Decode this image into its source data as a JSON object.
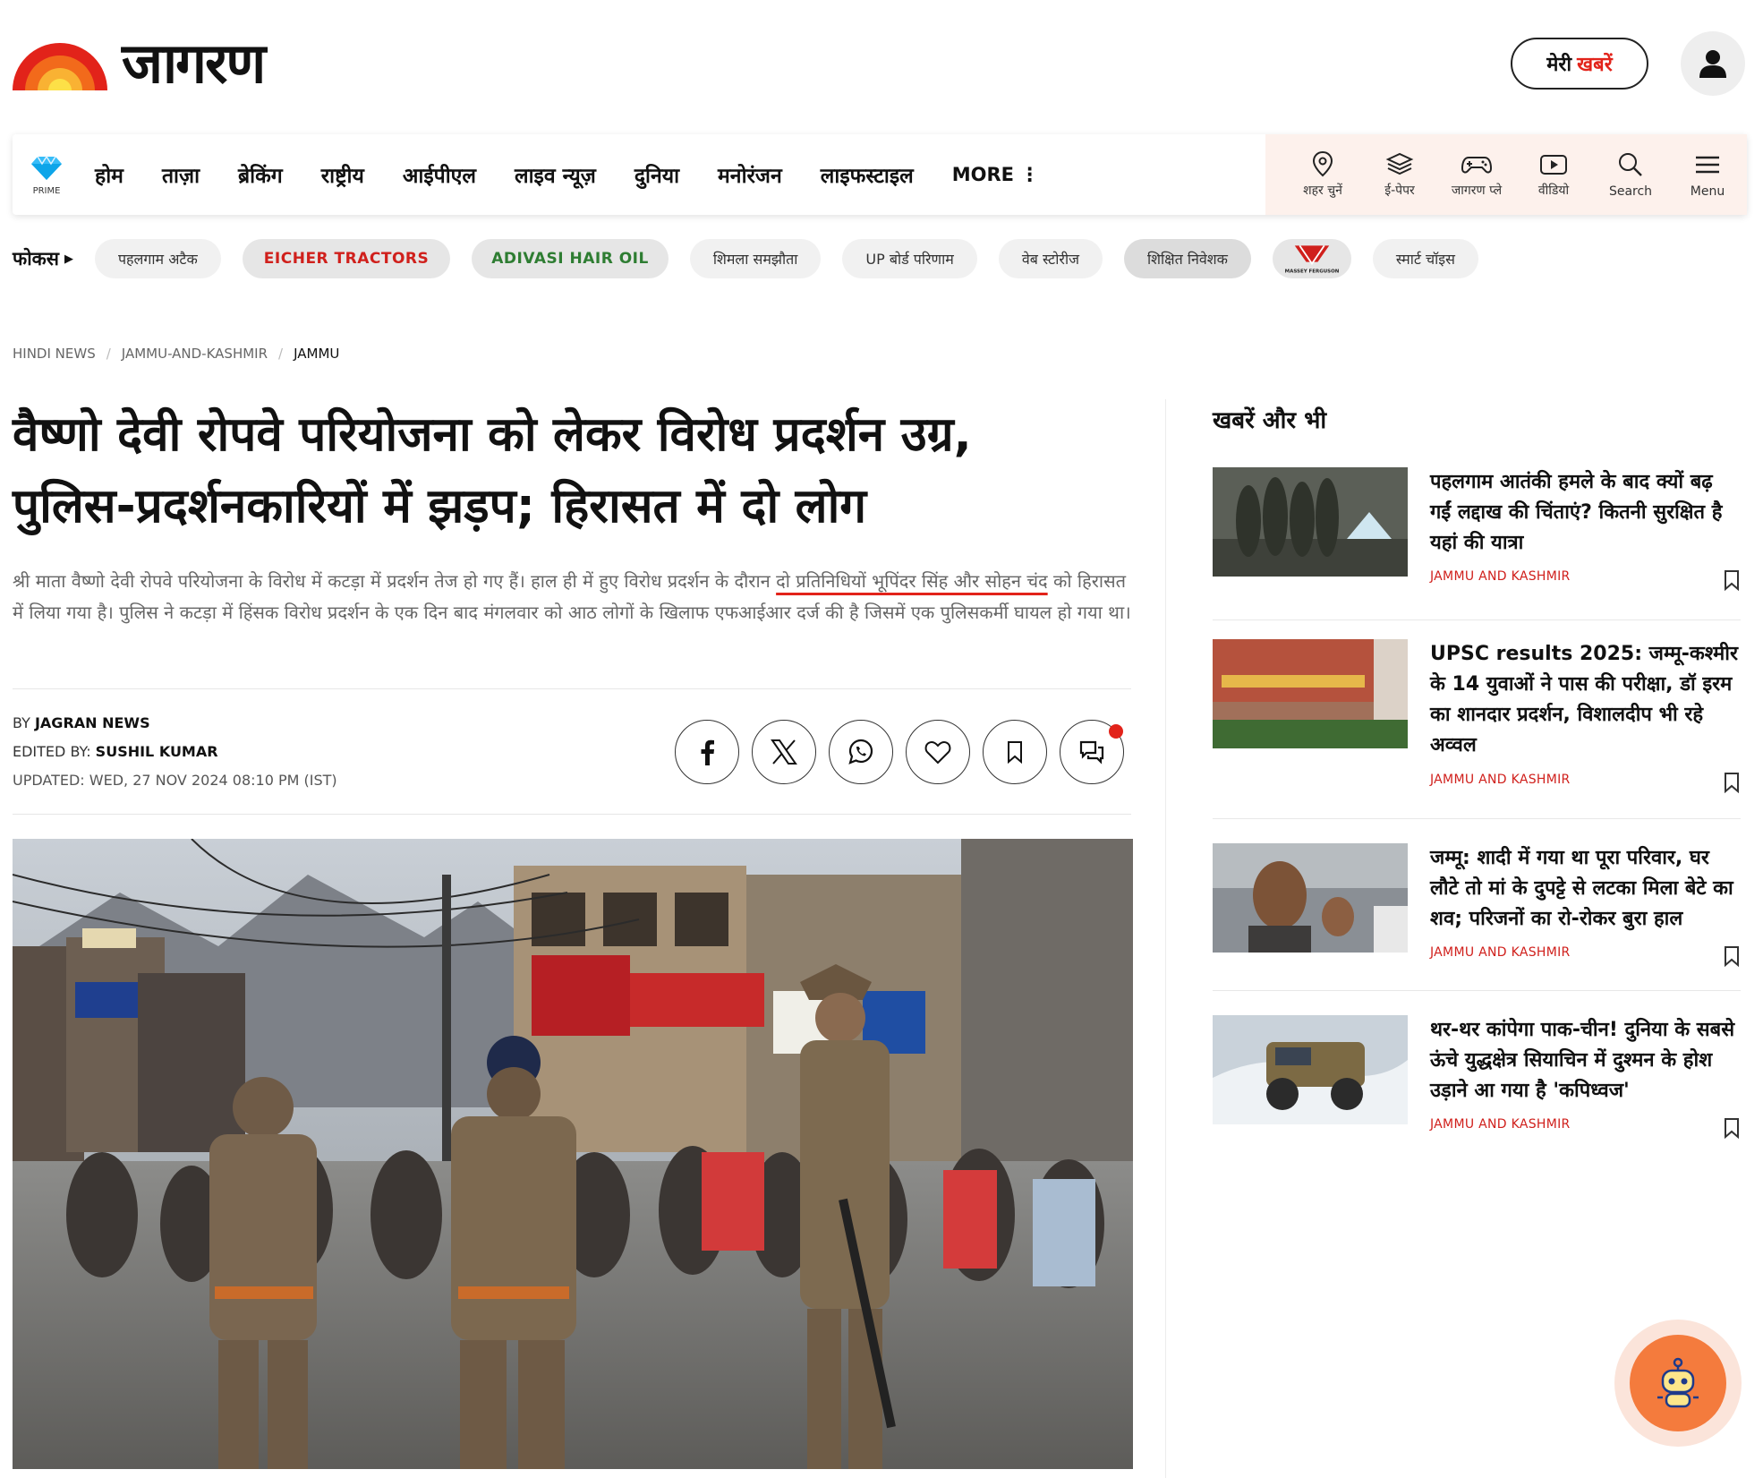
{
  "header": {
    "logo_text": "जागरण",
    "meri_prefix": "मेरी",
    "meri_accent": "खबरें"
  },
  "nav": {
    "prime_label": "PRIME",
    "items": [
      "होम",
      "ताज़ा",
      "ब्रेकिंग",
      "राष्ट्रीय",
      "आईपीएल",
      "लाइव न्यूज़",
      "दुनिया",
      "मनोरंजन",
      "लाइफस्टाइल"
    ],
    "more": "MORE ⋮",
    "icons": [
      {
        "label": "शहर चुनें",
        "icon": "location-pin-icon"
      },
      {
        "label": "ई-पेपर",
        "icon": "epaper-icon"
      },
      {
        "label": "जागरण प्ले",
        "icon": "gamepad-icon"
      },
      {
        "label": "वीडियो",
        "icon": "video-play-icon"
      },
      {
        "label": "Search",
        "icon": "search-icon"
      },
      {
        "label": "Menu",
        "icon": "hamburger-menu-icon"
      }
    ]
  },
  "focus": {
    "label": "फोकस",
    "chips": [
      "पहलगाम अटैक",
      "EICHER TRACTORS",
      "ADIVASI HAIR OIL",
      "शिमला समझौता",
      "UP बोर्ड परिणाम",
      "वेब स्टोरीज",
      "शिक्षित निवेशक",
      "MASSEY FERGUSON",
      "स्मार्ट चॉइस"
    ]
  },
  "breadcrumb": [
    "HINDI NEWS",
    "JAMMU-AND-KASHMIR",
    "JAMMU"
  ],
  "article": {
    "headline_line1": "वैष्णो देवी रोपवे परियोजना को लेकर विरोध प्रदर्शन उग्र,",
    "headline_line2": "पुलिस-प्रदर्शनकारियों में झड़प; हिरासत में दो लोग",
    "summary_part1": "श्री माता वैष्णो देवी रोपवे परियोजना के विरोध में कटड़ा में प्रदर्शन तेज हो गए हैं। हाल ही में हुए विरोध प्रदर्शन के दौरान ",
    "summary_underlined": "दो प्रतिनिधियों भूपिंदर सिंह और सोहन चंद",
    "summary_part2": " को हिरासत में लिया गया है। पुलिस ने कटड़ा में हिंसक विरोध प्रदर्शन के एक दिन बाद मंगलवार को आठ लोगों के खिलाफ एफआईआर दर्ज की है जिसमें एक पुलिसकर्मी घायल हो गया था।",
    "by_prefix": "BY",
    "author": "JAGRAN NEWS",
    "edited_prefix": "EDITED BY:",
    "editor": "SUSHIL KUMAR",
    "updated": "UPDATED: WED, 27 NOV 2024 08:10 PM (IST)"
  },
  "sidebar": {
    "title": "खबरें और भी",
    "items": [
      {
        "headline": "पहलगाम आतंकी हमले के बाद क्यों बढ़ गईं लद्दाख की चिंताएं? कितनी सुरक्षित है यहां की यात्रा",
        "category": "JAMMU AND KASHMIR"
      },
      {
        "headline": "UPSC results 2025: जम्मू-कश्मीर के 14 युवाओं ने पास की परीक्षा, डॉ इरम का शानदार प्रदर्शन, विशालदीप भी रहे अव्वल",
        "category": "JAMMU AND KASHMIR"
      },
      {
        "headline": "जम्मू: शादी में गया था पूरा परिवार, घर लौटे तो मां के दुपट्टे से लटका मिला बेटे का शव; परिजनों का रो-रोकर बुरा हाल",
        "category": "JAMMU AND KASHMIR"
      },
      {
        "headline": "थर-थर कांपेगा पाक-चीन! दुनिया के सबसे ऊंचे युद्धक्षेत्र सियाचिन में दुश्मन के होश उड़ाने आ गया है 'कपिध्वज'",
        "category": "JAMMU AND KASHMIR"
      }
    ]
  },
  "colors": {
    "brand_red": "#e2231a",
    "category_red": "#d0201c",
    "nav_right_bg": "#fdf1ec",
    "bot_orange": "#f47b3d"
  }
}
